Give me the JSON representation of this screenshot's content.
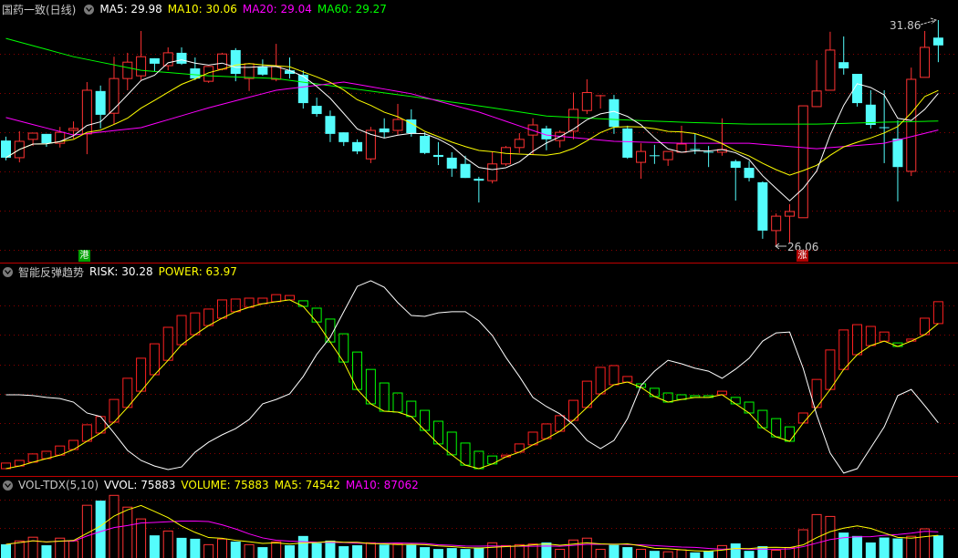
{
  "header": {
    "title": "国药一致(日线)",
    "ma5": "MA5: 29.98",
    "ma10": "MA10: 30.06",
    "ma20": "MA20: 29.04",
    "ma60": "MA60: 29.27"
  },
  "indicator_header": {
    "title": "智能反弹趋势",
    "risk": "RISK: 30.28",
    "power": "POWER: 63.97"
  },
  "volume_header": {
    "title": "VOL-TDX(5,10)",
    "vvol": "VVOL: 75883",
    "volume": "VOLUME: 75883",
    "ma5": "MA5: 74542",
    "ma10": "MA10: 87062"
  },
  "markers": {
    "hk": "港",
    "rise": "涨"
  },
  "annotations": {
    "high": "31.86",
    "low": "26.06"
  },
  "colors": {
    "up": "#ff3232",
    "down": "#54fcfc",
    "ma5": "#ffffff",
    "ma10": "#ffff00",
    "ma20": "#ff00ff",
    "ma60": "#00ff00",
    "grid": "#8a0000",
    "separator": "#c00000",
    "risk": "#ffffff",
    "power": "#ffff00",
    "power_up": "#ff2020",
    "power_down": "#00ff00"
  },
  "chart_data": [
    {
      "type": "candlestick",
      "title": "国药一致(日线)",
      "ohlc": [
        [
          28.77,
          28.87,
          28.26,
          28.33
        ],
        [
          28.33,
          29.01,
          28.21,
          28.75
        ],
        [
          28.8,
          28.96,
          28.63,
          28.96
        ],
        [
          28.94,
          28.94,
          28.61,
          28.7
        ],
        [
          28.7,
          29.12,
          28.59,
          28.98
        ],
        [
          29.03,
          29.26,
          28.82,
          29.08
        ],
        [
          28.94,
          30.27,
          28.42,
          30.06
        ],
        [
          30.04,
          30.18,
          29.08,
          29.43
        ],
        [
          29.47,
          30.92,
          29.17,
          30.36
        ],
        [
          30.36,
          31.02,
          30.06,
          30.78
        ],
        [
          30.43,
          31.58,
          30.32,
          30.92
        ],
        [
          30.88,
          30.88,
          30.55,
          30.74
        ],
        [
          30.69,
          31.16,
          30.57,
          31.02
        ],
        [
          31.02,
          31.16,
          30.71,
          30.74
        ],
        [
          30.62,
          30.9,
          30.32,
          30.36
        ],
        [
          30.29,
          30.67,
          30.25,
          30.67
        ],
        [
          30.6,
          31.02,
          30.57,
          30.99
        ],
        [
          31.09,
          31.14,
          30.29,
          30.48
        ],
        [
          30.36,
          30.76,
          30.04,
          30.74
        ],
        [
          30.67,
          30.85,
          30.43,
          30.46
        ],
        [
          30.34,
          31.25,
          30.29,
          30.67
        ],
        [
          30.57,
          30.9,
          30.36,
          30.48
        ],
        [
          30.46,
          30.57,
          29.59,
          29.73
        ],
        [
          29.66,
          29.87,
          29.38,
          29.45
        ],
        [
          29.4,
          29.54,
          28.73,
          28.94
        ],
        [
          28.98,
          28.98,
          28.63,
          28.73
        ],
        [
          28.73,
          28.8,
          28.42,
          28.49
        ],
        [
          28.3,
          29.12,
          28.19,
          29.03
        ],
        [
          29.08,
          29.34,
          28.84,
          28.98
        ],
        [
          29.03,
          29.71,
          28.91,
          29.31
        ],
        [
          29.31,
          29.57,
          28.87,
          28.96
        ],
        [
          28.89,
          28.98,
          28.42,
          28.45
        ],
        [
          28.4,
          28.73,
          28.14,
          28.35
        ],
        [
          28.33,
          28.47,
          27.84,
          28.05
        ],
        [
          28.17,
          28.38,
          27.81,
          27.81
        ],
        [
          27.79,
          27.84,
          27.18,
          27.74
        ],
        [
          27.74,
          28.49,
          27.67,
          28.17
        ],
        [
          28.17,
          28.63,
          28.12,
          28.59
        ],
        [
          28.59,
          28.96,
          28.45,
          28.8
        ],
        [
          28.91,
          29.34,
          28.4,
          29.17
        ],
        [
          29.08,
          29.15,
          28.52,
          28.8
        ],
        [
          28.77,
          29.03,
          28.59,
          28.98
        ],
        [
          29.01,
          30.0,
          28.8,
          29.57
        ],
        [
          29.54,
          30.34,
          29.45,
          30.0
        ],
        [
          29.9,
          29.94,
          29.59,
          29.92
        ],
        [
          29.83,
          29.94,
          28.94,
          29.12
        ],
        [
          29.08,
          29.15,
          28.3,
          28.33
        ],
        [
          28.21,
          28.7,
          27.79,
          28.49
        ],
        [
          28.38,
          28.66,
          28.17,
          28.35
        ],
        [
          28.28,
          28.49,
          28.12,
          28.49
        ],
        [
          28.47,
          29.15,
          28.47,
          28.68
        ],
        [
          28.54,
          28.94,
          28.42,
          28.53
        ],
        [
          28.47,
          28.63,
          28.09,
          28.46
        ],
        [
          28.47,
          29.34,
          28.38,
          28.54
        ],
        [
          28.24,
          28.28,
          27.23,
          28.07
        ],
        [
          28.07,
          28.24,
          27.72,
          27.81
        ],
        [
          27.7,
          27.72,
          26.25,
          26.46
        ],
        [
          26.46,
          26.9,
          26.06,
          26.83
        ],
        [
          26.83,
          27.14,
          26.15,
          26.95
        ],
        [
          26.79,
          29.66,
          26.79,
          29.66
        ],
        [
          29.64,
          30.83,
          29.64,
          30.04
        ],
        [
          30.06,
          31.56,
          30.06,
          31.09
        ],
        [
          30.78,
          31.44,
          30.46,
          30.62
        ],
        [
          30.48,
          30.48,
          29.64,
          29.73
        ],
        [
          29.69,
          30.06,
          29.08,
          29.17
        ],
        [
          29.1,
          30.06,
          28.19,
          29.09
        ],
        [
          28.82,
          29.29,
          27.21,
          28.09
        ],
        [
          27.98,
          30.64,
          27.86,
          30.34
        ],
        [
          30.39,
          31.58,
          30.39,
          31.16
        ],
        [
          31.41,
          31.86,
          30.78,
          31.21
        ]
      ],
      "ma20_samples": [
        [
          0,
          29.36
        ],
        [
          5,
          28.91
        ],
        [
          10,
          29.1
        ],
        [
          15,
          29.61
        ],
        [
          20,
          30.06
        ],
        [
          25,
          30.27
        ],
        [
          30,
          29.97
        ],
        [
          35,
          29.5
        ],
        [
          40,
          28.91
        ],
        [
          45,
          28.75
        ],
        [
          50,
          28.7
        ],
        [
          55,
          28.7
        ],
        [
          60,
          28.56
        ],
        [
          65,
          28.7
        ],
        [
          69,
          29.04
        ]
      ],
      "ma60_samples": [
        [
          0,
          31.39
        ],
        [
          5,
          30.92
        ],
        [
          10,
          30.57
        ],
        [
          15,
          30.43
        ],
        [
          20,
          30.36
        ],
        [
          25,
          30.13
        ],
        [
          30,
          29.9
        ],
        [
          35,
          29.66
        ],
        [
          40,
          29.4
        ],
        [
          45,
          29.31
        ],
        [
          50,
          29.24
        ],
        [
          55,
          29.19
        ],
        [
          60,
          29.19
        ],
        [
          65,
          29.24
        ],
        [
          69,
          29.27
        ]
      ],
      "ylim": [
        25.9,
        32.3
      ],
      "grid": true
    },
    {
      "type": "bar+line",
      "title": "智能反弹趋势",
      "risk": [
        39.8,
        39.8,
        39.5,
        38.9,
        38.5,
        37.3,
        33.6,
        32.4,
        26.8,
        20.9,
        17.5,
        15.6,
        14.4,
        15.3,
        20.3,
        23.7,
        26.2,
        28.3,
        31.4,
        36.7,
        38.2,
        40.1,
        46.0,
        53.5,
        59.3,
        68.0,
        76.6,
        78.5,
        76.3,
        71.1,
        66.7,
        66.4,
        67.6,
        68.0,
        68.0,
        64.9,
        59.9,
        52.5,
        46.0,
        38.9,
        35.8,
        33.3,
        29.6,
        24.3,
        21.5,
        24.3,
        31.7,
        42.9,
        47.8,
        51.5,
        50.3,
        48.8,
        47.8,
        45.4,
        48.5,
        52.2,
        58.0,
        60.8,
        61.1,
        48.8,
        33.0,
        20.0,
        13.2,
        14.7,
        21.8,
        28.9,
        39.5,
        41.6,
        36.1,
        30.28
      ],
      "power": [
        14.7,
        15.6,
        16.9,
        18.1,
        19.3,
        21.2,
        24.0,
        26.8,
        30.5,
        35.5,
        41.0,
        46.6,
        51.5,
        56.8,
        60.2,
        63.3,
        65.8,
        68.0,
        69.5,
        70.7,
        71.4,
        72.0,
        69.8,
        64.5,
        57.7,
        50.9,
        41.6,
        36.7,
        34.2,
        33.9,
        32.4,
        27.7,
        23.1,
        19.4,
        15.9,
        14.7,
        16.3,
        18.7,
        20.3,
        22.8,
        24.9,
        27.4,
        31.1,
        35.5,
        40.1,
        43.2,
        44.1,
        42.3,
        39.2,
        37.3,
        38.2,
        38.9,
        38.9,
        39.8,
        36.7,
        33.6,
        28.6,
        25.5,
        24.0,
        30.2,
        35.5,
        41.6,
        48.4,
        53.4,
        56.5,
        58.0,
        56.2,
        58.0,
        60.2,
        63.97
      ],
      "bar_high": [
        16.6,
        17.5,
        19.7,
        20.6,
        22.4,
        24.3,
        29.6,
        32.4,
        38.2,
        45.4,
        52.2,
        57.1,
        62.7,
        66.7,
        67.6,
        68.9,
        72.0,
        72.3,
        72.6,
        72.6,
        73.8,
        73.5,
        71.7,
        69.2,
        65.5,
        60.5,
        54.3,
        48.4,
        43.8,
        40.4,
        37.6,
        34.5,
        30.8,
        27.1,
        23.4,
        20.6,
        19.0,
        19.3,
        23.1,
        27.1,
        29.9,
        32.7,
        37.9,
        44.4,
        49.1,
        49.7,
        46.0,
        43.5,
        42.0,
        40.4,
        39.8,
        39.5,
        39.5,
        41.0,
        38.9,
        37.3,
        34.5,
        31.7,
        28.9,
        33.6,
        45.0,
        55.0,
        61.8,
        63.6,
        63.0,
        61.1,
        57.4,
        58.7,
        65.8,
        71.4
      ],
      "bar_trend": "RRRRRRRRRRRRRRRRRRRRRRGGGGGGGGGGGGGGGRRRRRRRRRRGGGGGGRGGGGGRRRRRRRGRRR",
      "grid": true
    },
    {
      "type": "bar+line",
      "title": "VOL-TDX(5,10)",
      "volume": [
        47000,
        58000,
        70000,
        44000,
        67000,
        58000,
        173000,
        188000,
        205000,
        167000,
        129000,
        76000,
        90000,
        68000,
        65000,
        46000,
        64000,
        56000,
        46000,
        38000,
        55000,
        44000,
        74000,
        51000,
        59000,
        41000,
        44000,
        52000,
        46000,
        49000,
        45000,
        38000,
        32000,
        35000,
        32000,
        37000,
        52000,
        43000,
        46000,
        48000,
        53000,
        31000,
        61000,
        67000,
        31000,
        45000,
        38000,
        31000,
        26000,
        23000,
        29000,
        21000,
        26000,
        43000,
        50000,
        26000,
        41000,
        28000,
        37000,
        94000,
        143000,
        137000,
        85000,
        74000,
        53000,
        69000,
        66000,
        73000,
        97000,
        75883
      ],
      "grid": true
    }
  ]
}
